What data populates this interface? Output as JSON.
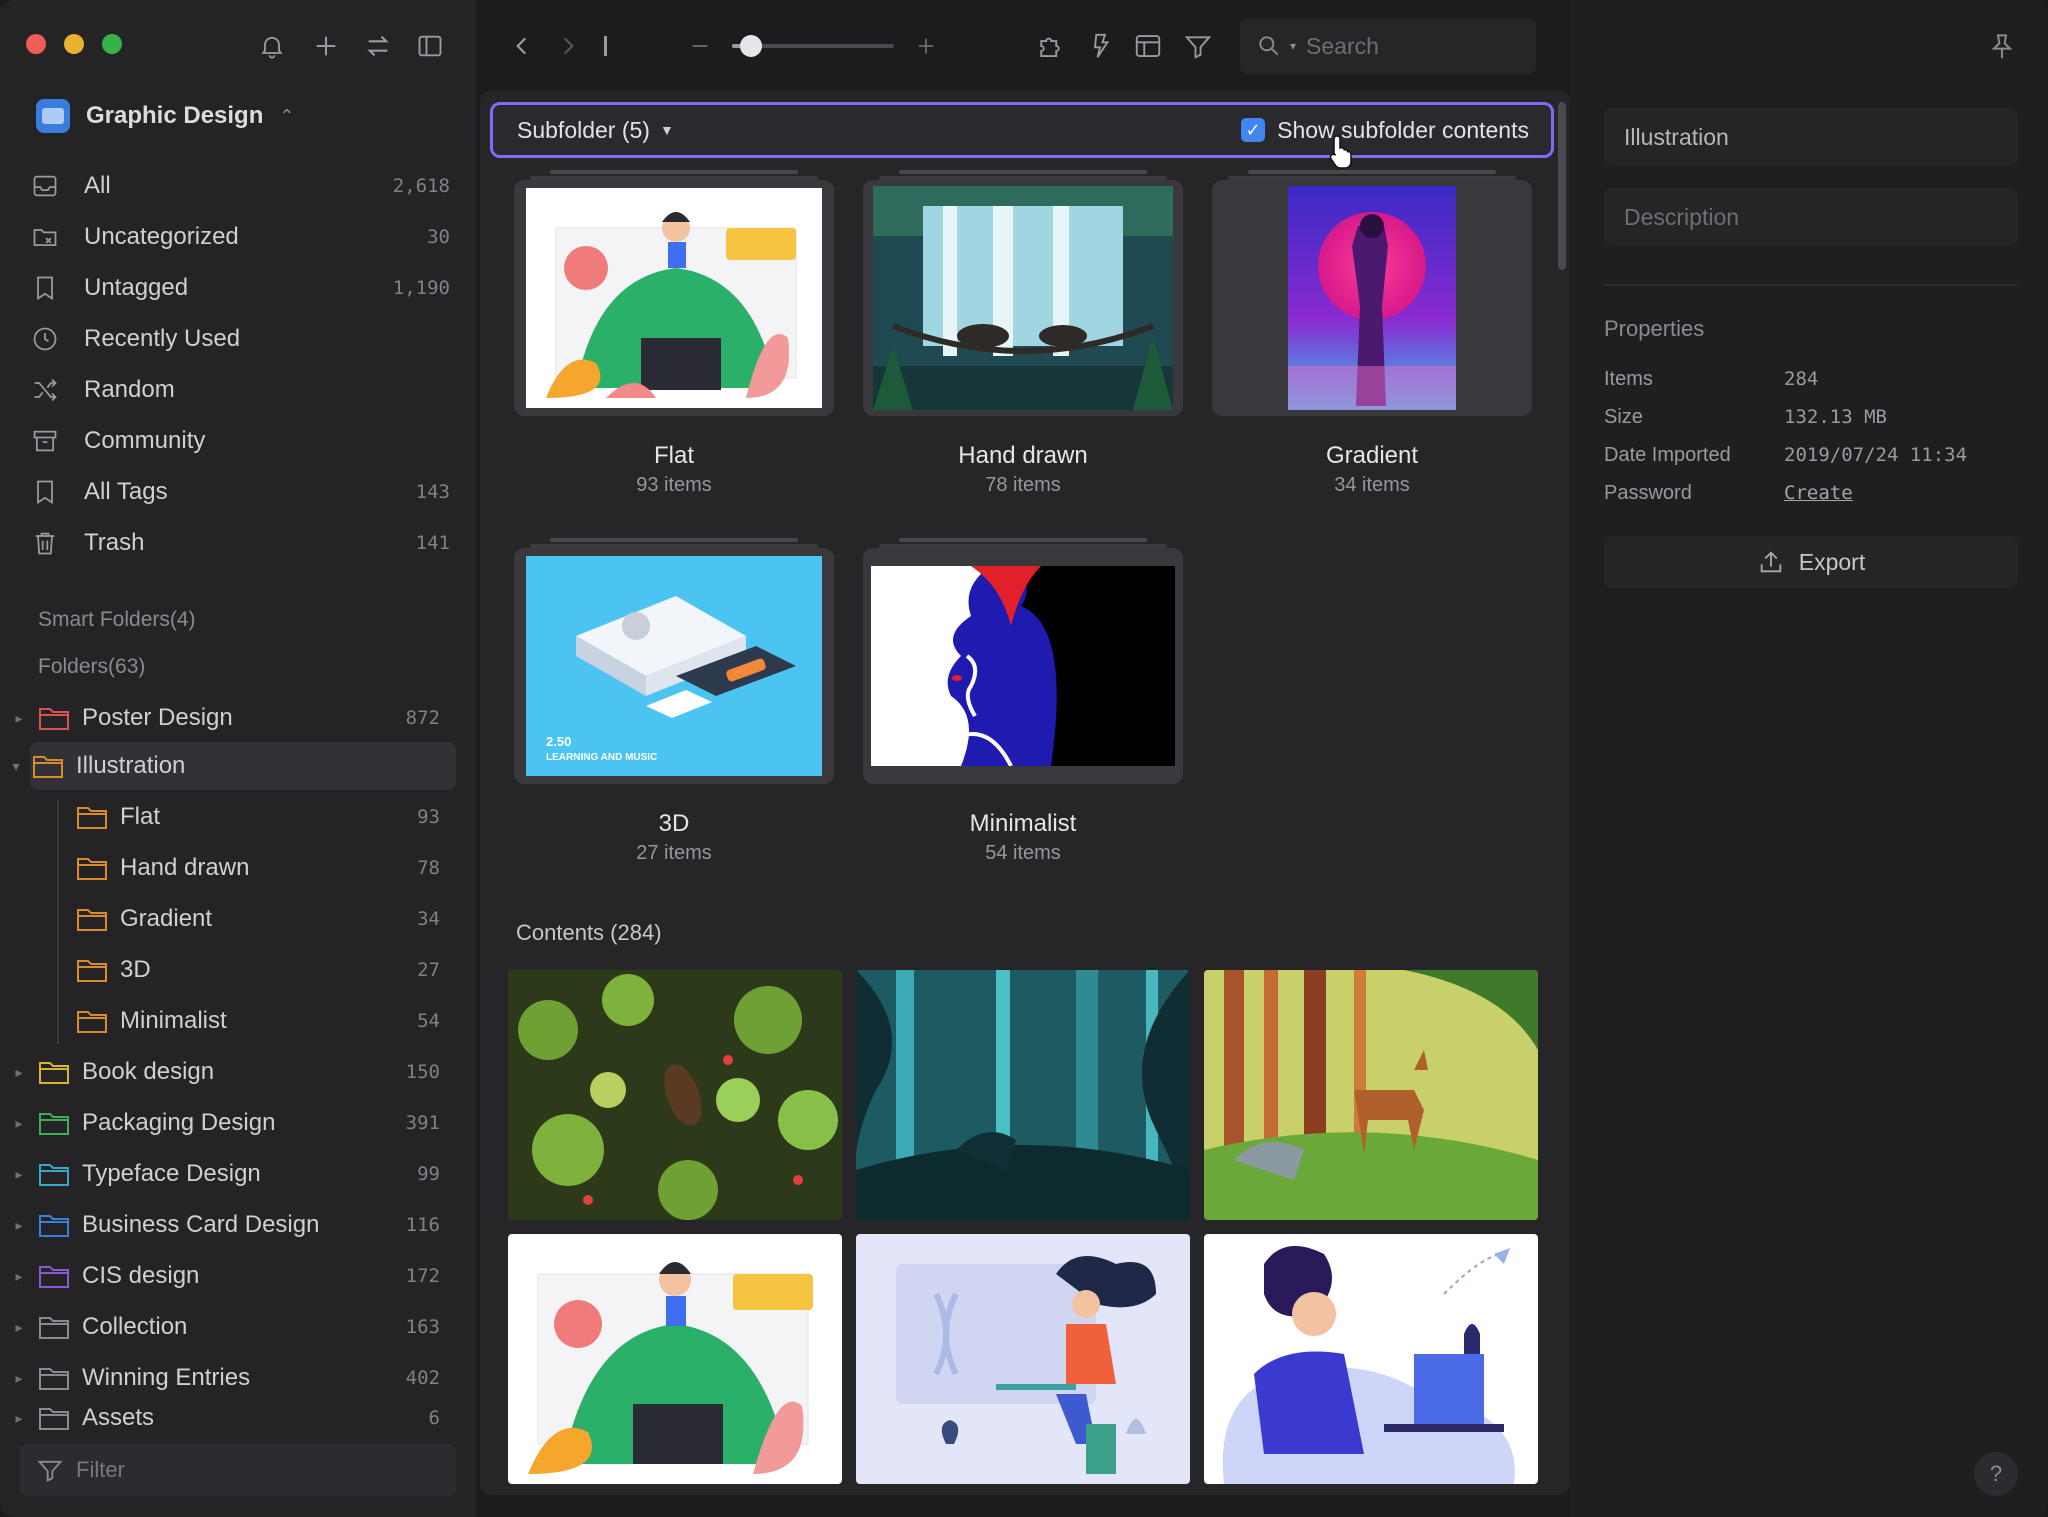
{
  "sidebar": {
    "library": {
      "name": "Graphic Design"
    },
    "nav": [
      {
        "label": "All",
        "count": "2,618",
        "icon": "inbox-icon"
      },
      {
        "label": "Uncategorized",
        "count": "30",
        "icon": "uncategorized-folder-icon"
      },
      {
        "label": "Untagged",
        "count": "1,190",
        "icon": "untagged-bookmark-icon"
      },
      {
        "label": "Recently Used",
        "count": "",
        "icon": "clock-icon"
      },
      {
        "label": "Random",
        "count": "",
        "icon": "shuffle-icon"
      },
      {
        "label": "Community",
        "count": "",
        "icon": "community-box-icon"
      },
      {
        "label": "All Tags",
        "count": "143",
        "icon": "bookmark-icon"
      },
      {
        "label": "Trash",
        "count": "141",
        "icon": "trash-icon"
      }
    ],
    "smart_folders_label": "Smart Folders(4)",
    "folders_label": "Folders(63)",
    "folders": [
      {
        "label": "Poster Design",
        "count": "872",
        "color": "#d9534f",
        "expanded": false
      },
      {
        "label": "Illustration",
        "count": "",
        "color": "#d98a2b",
        "expanded": true,
        "selected": true
      },
      {
        "label": "Flat",
        "count": "93",
        "color": "#d98a2b",
        "child": true
      },
      {
        "label": "Hand drawn",
        "count": "78",
        "color": "#d98a2b",
        "child": true
      },
      {
        "label": "Gradient",
        "count": "34",
        "color": "#d98a2b",
        "child": true
      },
      {
        "label": "3D",
        "count": "27",
        "color": "#d98a2b",
        "child": true
      },
      {
        "label": "Minimalist",
        "count": "54",
        "color": "#d98a2b",
        "child": true
      },
      {
        "label": "Book design",
        "count": "150",
        "color": "#d9b52b",
        "expanded": false
      },
      {
        "label": "Packaging Design",
        "count": "391",
        "color": "#3fae5a",
        "expanded": false
      },
      {
        "label": "Typeface Design",
        "count": "99",
        "color": "#35a7c9",
        "expanded": false
      },
      {
        "label": "Business Card Design",
        "count": "116",
        "color": "#3a7fd9",
        "expanded": false
      },
      {
        "label": "CIS design",
        "count": "172",
        "color": "#8a5ad0",
        "expanded": false
      },
      {
        "label": "Collection",
        "count": "163",
        "color": "#8a8a90",
        "expanded": false
      },
      {
        "label": "Winning Entries",
        "count": "402",
        "color": "#8a8a90",
        "expanded": false
      },
      {
        "label": "Assets",
        "count": "6",
        "color": "#8a8a90",
        "expanded": false
      }
    ],
    "filter_placeholder": "Filter"
  },
  "toolbar": {
    "search_placeholder": "Search",
    "zoom_fraction": 0.18
  },
  "main": {
    "subfolder_title": "Subfolder (5)",
    "show_subfolder_label": "Show subfolder contents",
    "show_subfolder_checked": true,
    "subfolders": [
      {
        "name": "Flat",
        "items": "93 items"
      },
      {
        "name": "Hand drawn",
        "items": "78 items"
      },
      {
        "name": "Gradient",
        "items": "34 items"
      },
      {
        "name": "3D",
        "items": "27 items"
      },
      {
        "name": "Minimalist",
        "items": "54 items"
      }
    ],
    "contents_label": "Contents (284)",
    "threed_caption_line1": "2.50",
    "threed_caption_line2": "LEARNING AND MUSIC"
  },
  "inspector": {
    "name_value": "Illustration",
    "description_placeholder": "Description",
    "properties_title": "Properties",
    "properties": [
      {
        "key": "Items",
        "value": "284"
      },
      {
        "key": "Size",
        "value": "132.13 MB"
      },
      {
        "key": "Date Imported",
        "value": "2019/07/24 11:34"
      },
      {
        "key": "Password",
        "value": "Create"
      }
    ],
    "export_label": "Export",
    "help_label": "?"
  }
}
